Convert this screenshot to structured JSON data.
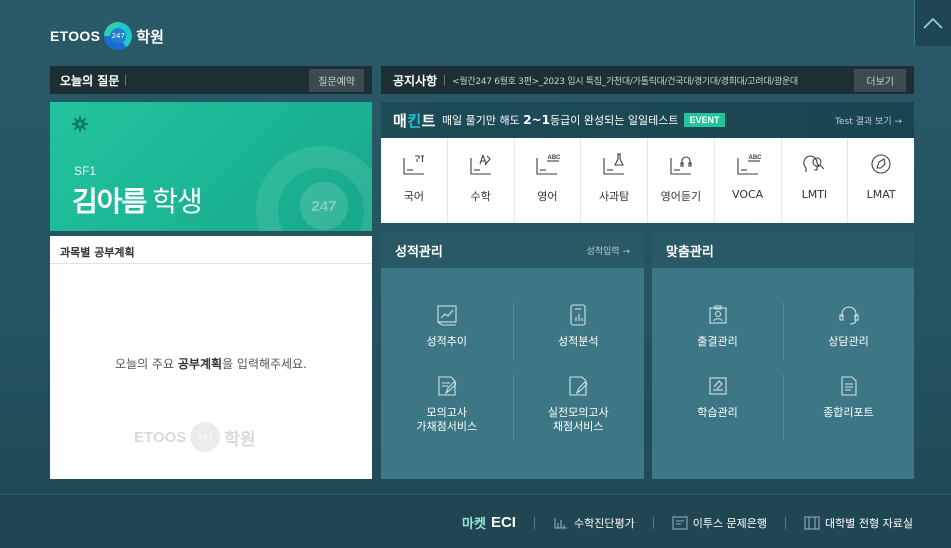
{
  "header": {
    "brand": "ETOOS",
    "badge": "247",
    "academy": "학원"
  },
  "question_bar": {
    "title": "오늘의 질문",
    "button": "질문예약"
  },
  "notice_bar": {
    "title": "공지사항",
    "text": "<월간247 6월호 3편>_2023 입시 특집_가천대/가톨릭대/건국대/경기대/경희대/고려대/광운대",
    "button": "더보기"
  },
  "student": {
    "class": "SF1",
    "name": "김아름",
    "suffix": "학생",
    "watermark": "247"
  },
  "plan": {
    "title": "과목별 공부계획",
    "msg_before": "오늘의 주요 ",
    "msg_bold": "공부계획",
    "msg_after": "을 입력해주세요.",
    "watermark_brand": "ETOOS",
    "watermark_badge": "247",
    "watermark_academy": "학원"
  },
  "mecheck": {
    "logo_a": "매",
    "logo_b": "킨",
    "logo_c": "트",
    "desc_a": "매일 풀기만 해도 ",
    "desc_b": "2~1",
    "desc_c": "등급이 완성되는 일일테스트",
    "event": "EVENT",
    "more": "Test 결과 보기 →",
    "items": [
      {
        "label": "국어",
        "icon": "korean-icon"
      },
      {
        "label": "수학",
        "icon": "math-icon"
      },
      {
        "label": "영어",
        "icon": "english-icon"
      },
      {
        "label": "사과탐",
        "icon": "science-icon"
      },
      {
        "label": "영어듣기",
        "icon": "listening-icon"
      },
      {
        "label": "VOCA",
        "icon": "voca-icon"
      },
      {
        "label": "LMTI",
        "icon": "lmti-icon"
      },
      {
        "label": "LMAT",
        "icon": "lmat-icon"
      }
    ]
  },
  "score": {
    "title": "성적관리",
    "link": "성적입력 →",
    "items": [
      {
        "label": "성적추이",
        "icon": "trend-icon"
      },
      {
        "label": "성적분석",
        "icon": "analysis-icon"
      },
      {
        "label": "모의고사\n가채점서비스",
        "icon": "mock-exam-icon"
      },
      {
        "label": "실전모의고사\n채점서비스",
        "icon": "real-exam-icon"
      }
    ]
  },
  "custom": {
    "title": "맞춤관리",
    "items": [
      {
        "label": "출결관리",
        "icon": "attendance-icon"
      },
      {
        "label": "상담관리",
        "icon": "counseling-icon"
      },
      {
        "label": "학습관리",
        "icon": "study-icon"
      },
      {
        "label": "종합리포트",
        "icon": "report-icon"
      }
    ]
  },
  "footer": {
    "eci_pre": "마켓",
    "eci": "ECI",
    "links": [
      {
        "label": "수학진단평가",
        "icon": "diagnosis-icon"
      },
      {
        "label": "이투스 문제은행",
        "icon": "question-bank-icon"
      },
      {
        "label": "대학별 전형 자료실",
        "icon": "library-icon"
      }
    ]
  },
  "colors": {
    "accent_green": "#22c49e",
    "panel_teal": "#3d7684",
    "background": "#24525f"
  }
}
